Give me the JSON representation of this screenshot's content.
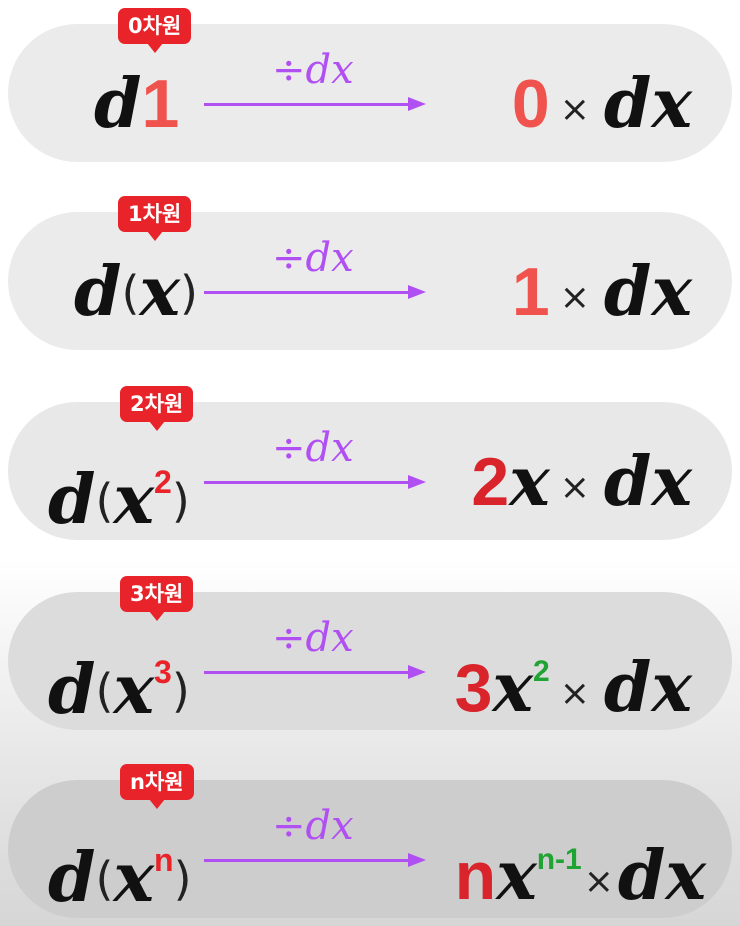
{
  "arrow_label": "÷dx",
  "times_symbol": "×",
  "dx": "dx",
  "rows": [
    {
      "badge": "0차원",
      "lhs_d": "d",
      "lhs_core": "1",
      "rhs_coef": "0",
      "rhs_var": "",
      "rhs_exp": ""
    },
    {
      "badge": "1차원",
      "lhs_d": "d",
      "lhs_open": "(",
      "lhs_var": "x",
      "lhs_close": ")",
      "rhs_coef": "1",
      "rhs_var": "",
      "rhs_exp": ""
    },
    {
      "badge": "2차원",
      "lhs_d": "d",
      "lhs_open": "(",
      "lhs_var": "x",
      "lhs_exp": "2",
      "lhs_close": ")",
      "rhs_coef": "2",
      "rhs_var": "x",
      "rhs_exp": ""
    },
    {
      "badge": "3차원",
      "lhs_d": "d",
      "lhs_open": "(",
      "lhs_var": "x",
      "lhs_exp": "3",
      "lhs_close": ")",
      "rhs_coef": "3",
      "rhs_var": "x",
      "rhs_exp": "2"
    },
    {
      "badge": "n차원",
      "lhs_d": "d",
      "lhs_open": "(",
      "lhs_var": "x",
      "lhs_exp": "n",
      "lhs_close": ")",
      "rhs_coef": "n",
      "rhs_var": "x",
      "rhs_exp": "n-1"
    }
  ],
  "colors": {
    "badge": "#e8232a",
    "arrow": "#b150f2",
    "coefficient_light": "#f0524d",
    "coefficient_dark": "#d8242a",
    "exponent_green": "#1fa333"
  }
}
